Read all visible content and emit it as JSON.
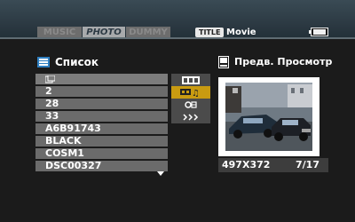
{
  "tabs": {
    "music": "MUSIC",
    "photo": "PHOTO",
    "dummy": "DUMMY"
  },
  "title_badge": "TITLE",
  "mode_label": "Movie",
  "battery_icon": "battery-icon",
  "list": {
    "heading": "Список",
    "icon": "list-icon",
    "items": [
      "2",
      "28",
      "33",
      "A6B91743",
      "BLACK",
      "COSM1",
      "DSC00327"
    ]
  },
  "mode_buttons": [
    "filmstrip-icon",
    "music-photo-icon",
    "settings-icon",
    "next-arrows-icon"
  ],
  "preview": {
    "heading": "Предв. Просмотр",
    "icon": "preview-icon",
    "resolution": "497X372",
    "counter": "7/17"
  },
  "colors": {
    "accent_selected": "#c99b11",
    "tab_active": "#a8aaac",
    "row_bg": "#6b6b6b"
  }
}
